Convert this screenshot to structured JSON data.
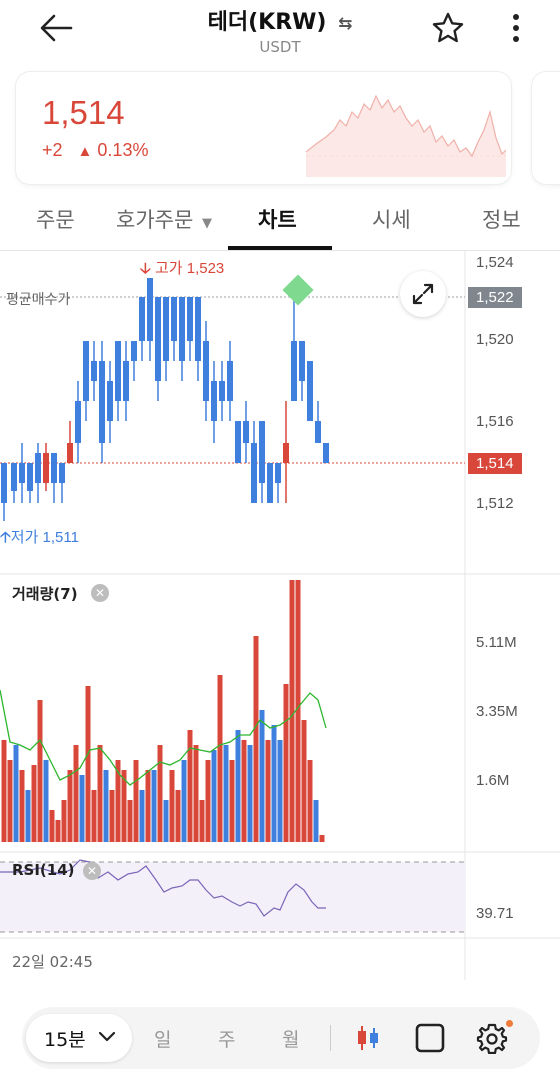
{
  "header": {
    "title": "테더(KRW)",
    "subtitle": "USDT"
  },
  "price_card": {
    "price": "1,514",
    "change_abs": "+2",
    "change_pct": "0.13%",
    "accent": "#d9473a"
  },
  "tabs": [
    {
      "label": "주문",
      "active": false
    },
    {
      "label": "호가주문",
      "active": false,
      "has_dropdown": true
    },
    {
      "label": "차트",
      "active": true
    },
    {
      "label": "시세",
      "active": false
    },
    {
      "label": "정보",
      "active": false
    }
  ],
  "chart": {
    "price_ticks": [
      "1,524",
      "1,522",
      "1,520",
      "1,516",
      "1,514",
      "1,512"
    ],
    "avg_buy_label": "평균매수가",
    "current_price_tag": "1,514",
    "avg_price_tag": "1,522",
    "high_label": "고가 1,523",
    "low_label": "저가 1,511",
    "volume_label": "거래량(7)",
    "volume_ticks": [
      "5.11M",
      "3.35M",
      "1.6M"
    ],
    "rsi_label": "RSI(14)",
    "rsi_value": "39.71",
    "time_label": "22일 02:45"
  },
  "bottom": {
    "interval": "15분",
    "periods": [
      "일",
      "주",
      "월"
    ]
  },
  "colors": {
    "up": "#d9473a",
    "down": "#3f7fdd",
    "ma": "#2db62d",
    "rsi": "#7a64b8"
  }
}
